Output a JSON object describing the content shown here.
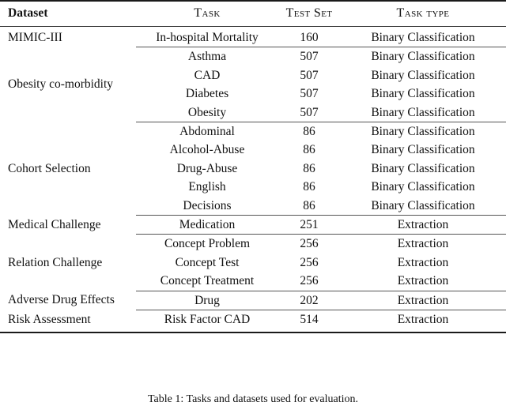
{
  "table": {
    "columns": [
      {
        "key": "dataset",
        "label": "Dataset",
        "style": "bold"
      },
      {
        "key": "task",
        "label": "Task",
        "style": "small-caps"
      },
      {
        "key": "test_set",
        "label": "Test Set",
        "style": "small-caps"
      },
      {
        "key": "task_type",
        "label": "Task type",
        "style": "small-caps"
      }
    ],
    "groups": [
      {
        "dataset": "MIMIC-III",
        "rows": [
          {
            "task": "In-hospital Mortality",
            "test_set": "160",
            "task_type": "Binary Classification"
          }
        ]
      },
      {
        "dataset": "Obesity co-morbidity",
        "rows": [
          {
            "task": "Asthma",
            "test_set": "507",
            "task_type": "Binary Classification"
          },
          {
            "task": "CAD",
            "test_set": "507",
            "task_type": "Binary Classification"
          },
          {
            "task": "Diabetes",
            "test_set": "507",
            "task_type": "Binary Classification"
          },
          {
            "task": "Obesity",
            "test_set": "507",
            "task_type": "Binary Classification"
          }
        ]
      },
      {
        "dataset": "Cohort Selection",
        "rows": [
          {
            "task": "Abdominal",
            "test_set": "86",
            "task_type": "Binary Classification"
          },
          {
            "task": "Alcohol-Abuse",
            "test_set": "86",
            "task_type": "Binary Classification"
          },
          {
            "task": "Drug-Abuse",
            "test_set": "86",
            "task_type": "Binary Classification"
          },
          {
            "task": "English",
            "test_set": "86",
            "task_type": "Binary Classification"
          },
          {
            "task": "Decisions",
            "test_set": "86",
            "task_type": "Binary Classification"
          }
        ]
      },
      {
        "dataset": "Medical Challenge",
        "rows": [
          {
            "task": "Medication",
            "test_set": "251",
            "task_type": "Extraction"
          }
        ]
      },
      {
        "dataset": "Relation Challenge",
        "rows": [
          {
            "task": "Concept Problem",
            "test_set": "256",
            "task_type": "Extraction"
          },
          {
            "task": "Concept Test",
            "test_set": "256",
            "task_type": "Extraction"
          },
          {
            "task": "Concept Treatment",
            "test_set": "256",
            "task_type": "Extraction"
          }
        ]
      },
      {
        "dataset": "Adverse Drug Effects",
        "rows": [
          {
            "task": "Drug",
            "test_set": "202",
            "task_type": "Extraction"
          }
        ]
      },
      {
        "dataset": "Risk Assessment",
        "rows": [
          {
            "task": "Risk Factor CAD",
            "test_set": "514",
            "task_type": "Extraction"
          }
        ]
      }
    ]
  },
  "caption": {
    "text": "Table 1: Tasks and datasets used for evaluation."
  }
}
